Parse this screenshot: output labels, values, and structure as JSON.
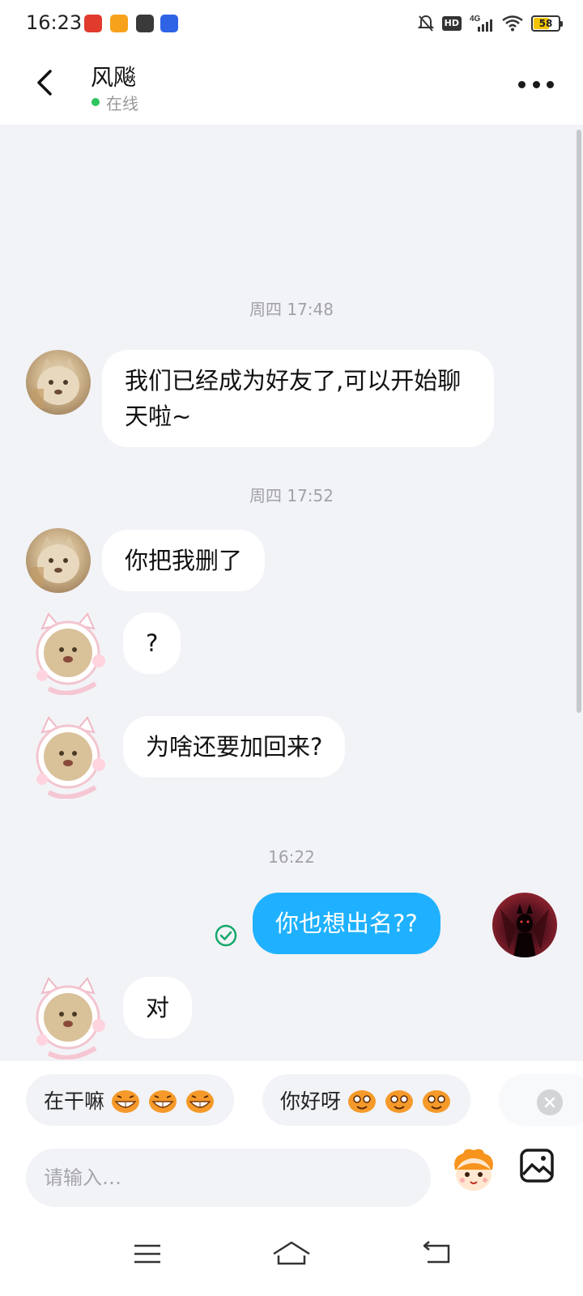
{
  "status_bar": {
    "time": "16:23",
    "network": "4G",
    "hd": "HD",
    "battery": "58",
    "battery_level": 0.58,
    "icons": [
      "gov-app-icon",
      "video-app-icon",
      "wallet-app-icon",
      "baidu-app-icon",
      "mute-bell-icon",
      "signal-icon",
      "wifi-icon",
      "battery-icon"
    ]
  },
  "header": {
    "contact_name": "风飚",
    "presence": "在线",
    "presence_color": "#2dc55e"
  },
  "messages": [
    {
      "type": "time",
      "text": "周四 17:48"
    },
    {
      "type": "incoming",
      "avatar": "cat-avatar",
      "text": "我们已经成为好友了,可以开始聊天啦~"
    },
    {
      "type": "time",
      "text": "周四 17:52"
    },
    {
      "type": "incoming",
      "avatar": "cat-avatar",
      "text": "你把我删了"
    },
    {
      "type": "incoming",
      "avatar": "cat-frame-avatar",
      "text": "?"
    },
    {
      "type": "incoming",
      "avatar": "cat-frame-avatar",
      "text": "为啥还要加回来?"
    },
    {
      "type": "time",
      "text": "16:22"
    },
    {
      "type": "outgoing",
      "avatar": "demon-avatar",
      "text": "你也想出名??",
      "status": "read-check-icon"
    },
    {
      "type": "incoming",
      "avatar": "cat-frame-avatar",
      "text": "对"
    }
  ],
  "quick_replies": [
    {
      "text": "在干嘛",
      "emoji": "grin-tiger-emoji"
    },
    {
      "text": "你好呀",
      "emoji": "happy-tiger-emoji"
    }
  ],
  "composer": {
    "placeholder": "请输入…",
    "value": ""
  },
  "colors": {
    "outgoing_bubble": "#1fb1ff",
    "incoming_bubble": "#ffffff",
    "chat_background": "#f2f3f7",
    "read_check": "#15a86b"
  }
}
